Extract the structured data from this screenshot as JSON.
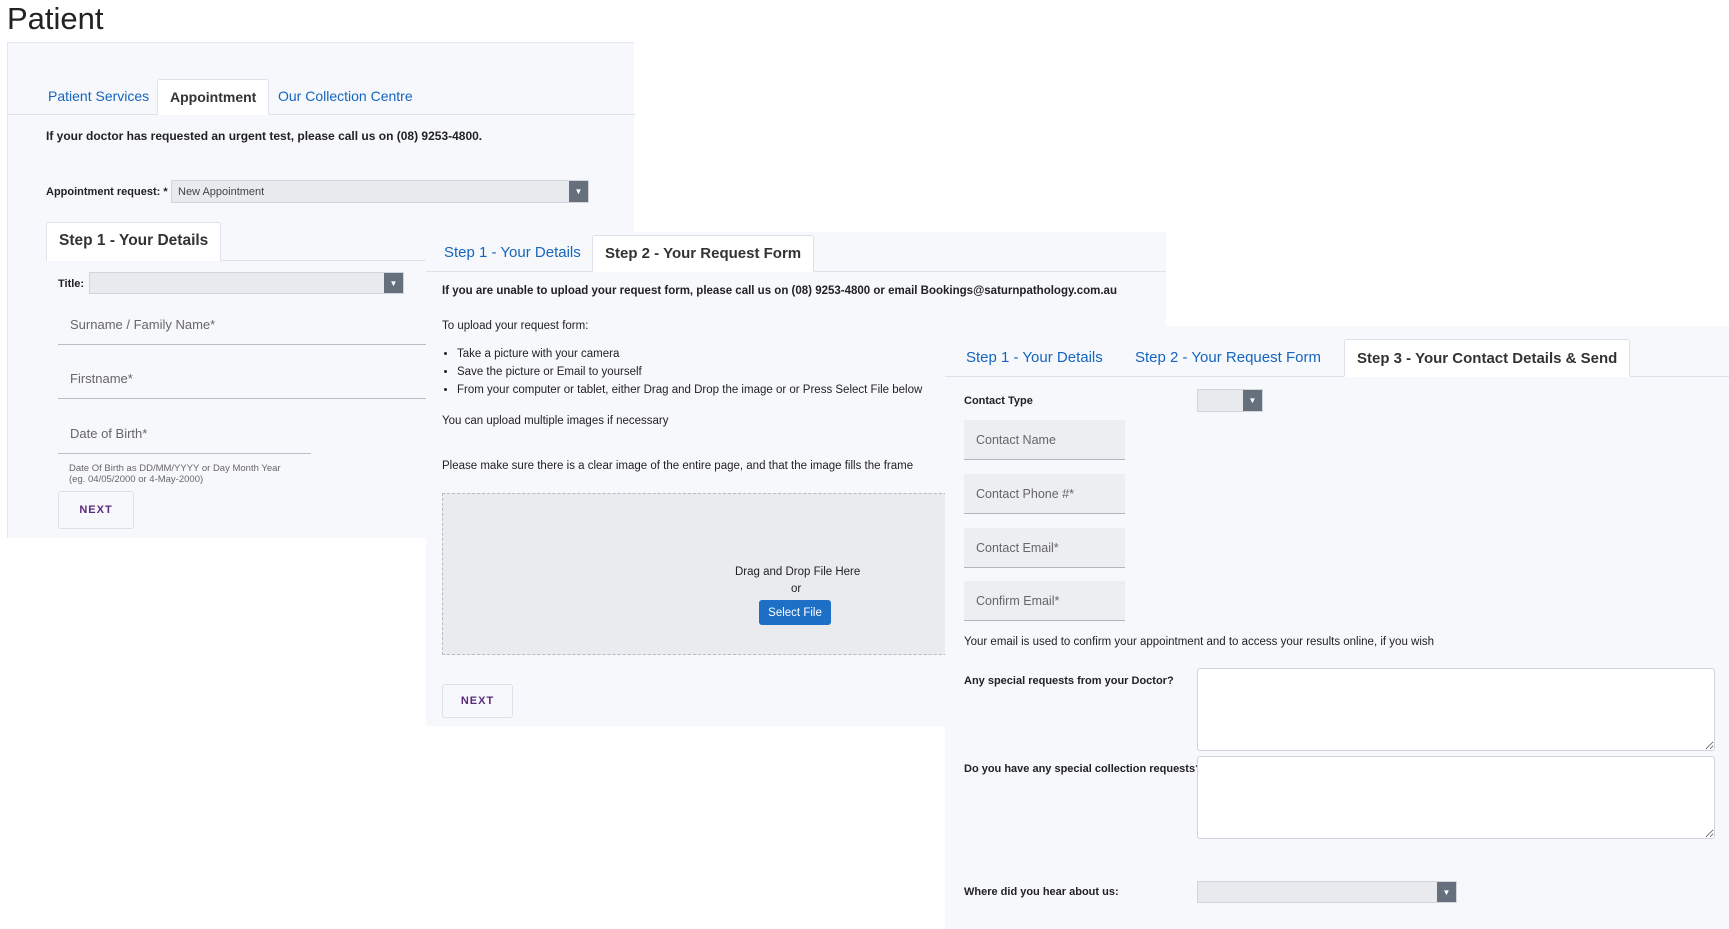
{
  "page": {
    "title": "Patient"
  },
  "panel1": {
    "tabs": [
      {
        "label": "Patient Services",
        "active": false
      },
      {
        "label": "Appointment",
        "active": true
      },
      {
        "label": "Our Collection Centre",
        "active": false
      }
    ],
    "urgent_note": "If your doctor has requested an urgent test, please call us on (08) 9253-4800.",
    "appointment_request_label": "Appointment request: *",
    "appointment_request_value": "New Appointment",
    "step_tab": "Step 1 - Your Details",
    "title_label": "Title:",
    "surname_placeholder": "Surname / Family Name*",
    "firstname_placeholder": "Firstname*",
    "dob_placeholder": "Date of Birth*",
    "dob_hint_line1": "Date Of Birth as DD/MM/YYYY or Day Month Year",
    "dob_hint_line2": "(eg. 04/05/2000 or 4-May-2000)",
    "next_label": "NEXT"
  },
  "panel2": {
    "tabs": [
      {
        "label": "Step 1 - Your Details",
        "active": false
      },
      {
        "label": "Step 2 - Your Request Form",
        "active": true
      }
    ],
    "unable_note": "If you are unable to upload your request form, please call us on (08) 9253-4800 or email Bookings@saturnpathology.com.au",
    "upload_intro": "To upload your request form:",
    "bullets": [
      "Take a picture with your camera",
      "Save the picture or Email to yourself",
      "From your computer or tablet, either Drag and Drop the image or or Press Select File below"
    ],
    "multiple_note": "You can upload multiple images if necessary",
    "clear_image_note": "Please make sure there is a clear image of the entire page, and that the image fills the frame",
    "drop_text": "Drag and Drop File Here",
    "or_text": "or",
    "select_file_label": "Select File",
    "next_label": "NEXT"
  },
  "panel3": {
    "tabs": [
      {
        "label": "Step 1 - Your Details",
        "active": false
      },
      {
        "label": "Step 2 - Your Request Form",
        "active": false
      },
      {
        "label": "Step 3 - Your Contact Details & Send",
        "active": true
      }
    ],
    "contact_type_label": "Contact Type",
    "contact_name_placeholder": "Contact Name",
    "contact_phone_placeholder": "Contact Phone #*",
    "contact_email_placeholder": "Contact Email*",
    "confirm_email_placeholder": "Confirm Email*",
    "email_note": "Your email is used to confirm your appointment and to access your results online, if you wish",
    "doctor_requests_label": "Any special requests from your Doctor?",
    "collection_requests_label": "Do you have any special collection requests?",
    "hear_about_label": "Where did you hear about us:"
  },
  "colors": {
    "link": "#1565c0",
    "button_blue": "#1e6fc6",
    "next_text": "#5a2b7a",
    "panel_bg": "#f7f8fb"
  }
}
